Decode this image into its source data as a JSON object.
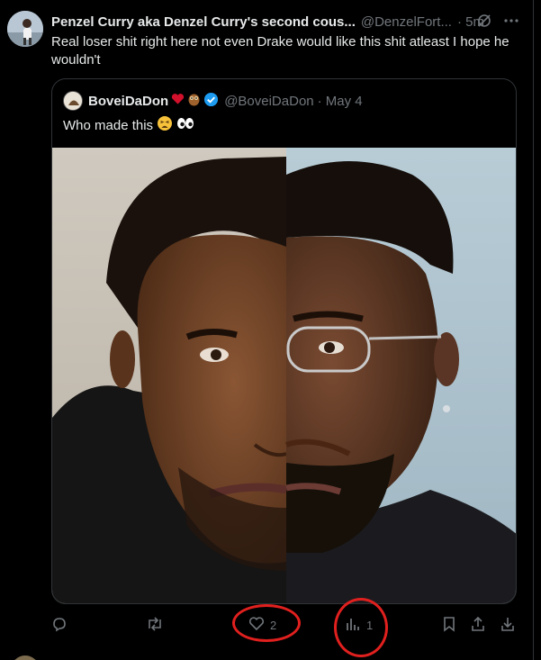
{
  "tweet": {
    "display_name": "Penzel Curry aka Denzel Curry's second cous...",
    "handle": "@DenzelFort...",
    "time": "· 5m",
    "text": "Real loser shit right here not even Drake would like this shit atleast I hope he wouldn't"
  },
  "quoted": {
    "display_name": "BoveiDaDon",
    "handle": "@BoveiDaDon",
    "date": "· May 4",
    "text": "Who made this",
    "emojis": [
      "tired-face",
      "eyes"
    ]
  },
  "actions": {
    "reply_count": "",
    "repost_count": "",
    "like_count": "2",
    "views_count": "1"
  },
  "colors": {
    "background": "#000000",
    "text": "#e7e9ea",
    "muted": "#71767b",
    "border": "#2f3336",
    "verified": "#1d9bf0",
    "annotation": "#e0201e"
  },
  "icons": [
    "grok-icon",
    "more-icon",
    "verified-badge-icon",
    "reply-icon",
    "repost-icon",
    "like-icon",
    "views-icon",
    "bookmark-icon",
    "share-icon",
    "download-icon"
  ]
}
